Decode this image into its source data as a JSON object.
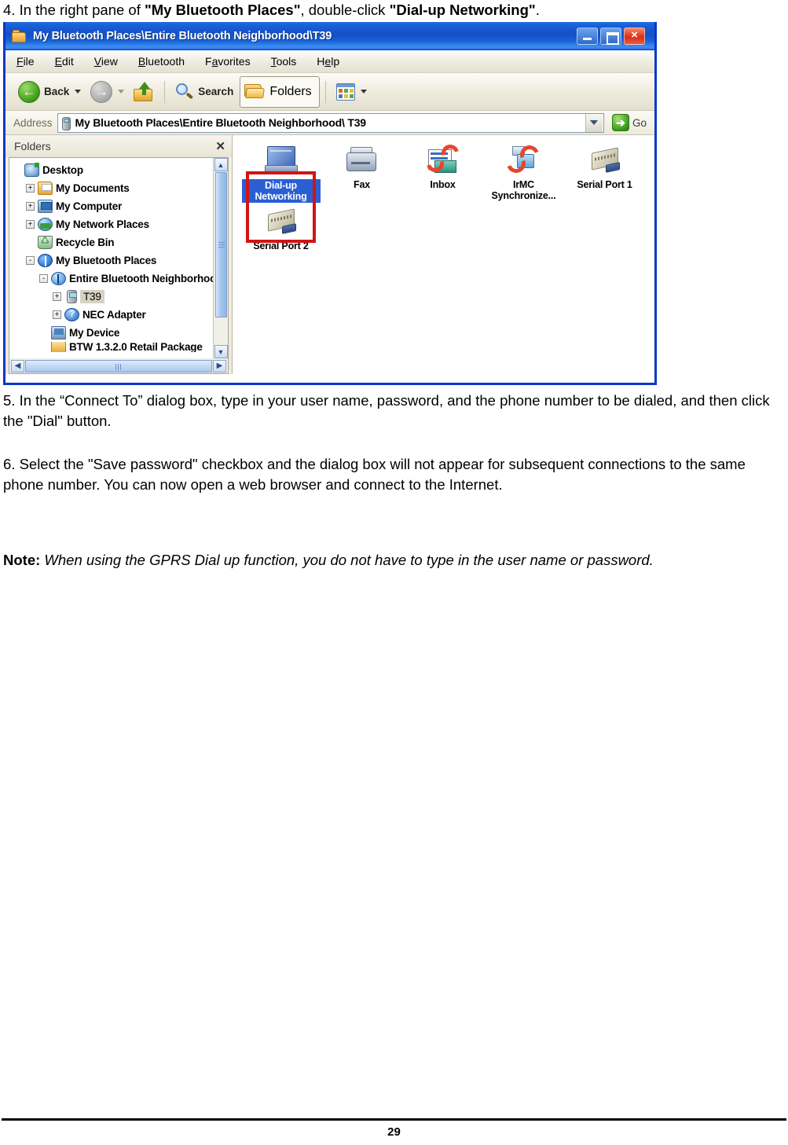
{
  "document": {
    "step4": {
      "prefix": "4. In the right pane of ",
      "bold1": "\"My Bluetooth Places\"",
      "middle": ", double-click ",
      "bold2": "\"Dial-up Networking\"",
      "suffix": "."
    },
    "step5": "5. In the “Connect To” dialog box, type in your user name, password, and the phone number to be dialed, and then click the \"Dial\" button.",
    "step6": "6. Select the \"Save password\" checkbox and the dialog box will not appear for subsequent connections to the same phone number. You can now open a web browser and connect to the Internet.",
    "note": {
      "label": "Note:",
      "text": "When using the GPRS Dial up function, you do not have to type in the user name or password."
    },
    "footer": {
      "page_number": "29"
    }
  },
  "window": {
    "title": "My Bluetooth Places\\Entire Bluetooth Neighborhood\\T39",
    "title_icon": "folder-icon",
    "caption_buttons": {
      "minimize": "minimize-button",
      "maximize": "maximize-button",
      "close": "×"
    },
    "menu": [
      {
        "label": "File",
        "accel": "F"
      },
      {
        "label": "Edit",
        "accel": "E"
      },
      {
        "label": "View",
        "accel": "V"
      },
      {
        "label": "Bluetooth",
        "accel": "B"
      },
      {
        "label": "Favorites",
        "accel": "a"
      },
      {
        "label": "Tools",
        "accel": "T"
      },
      {
        "label": "Help",
        "accel": "H"
      }
    ],
    "toolbar": {
      "back_label": "Back",
      "forward_label": "",
      "up_label": "",
      "search_label": "Search",
      "folders_label": "Folders",
      "views_label": ""
    },
    "address": {
      "label": "Address",
      "value": "My Bluetooth Places\\Entire Bluetooth Neighborhood\\ T39",
      "go_label": "Go"
    },
    "folders_pane": {
      "header": "Folders",
      "close_glyph": "✕",
      "tree": [
        {
          "label": "Desktop",
          "indent": 0,
          "expander": "",
          "icon": "desktop-icon",
          "selected": false
        },
        {
          "label": "My Documents",
          "indent": 1,
          "expander": "+",
          "icon": "my-documents-icon",
          "selected": false
        },
        {
          "label": "My Computer",
          "indent": 1,
          "expander": "+",
          "icon": "my-computer-icon",
          "selected": false
        },
        {
          "label": "My Network Places",
          "indent": 1,
          "expander": "+",
          "icon": "network-icon",
          "selected": false
        },
        {
          "label": "Recycle Bin",
          "indent": 1,
          "expander": "",
          "icon": "recycle-bin-icon",
          "selected": false
        },
        {
          "label": "My Bluetooth Places",
          "indent": 1,
          "expander": "-",
          "icon": "bluetooth-icon",
          "selected": false
        },
        {
          "label": "Entire Bluetooth Neighborhood",
          "indent": 2,
          "expander": "-",
          "icon": "bluetooth-globe-icon",
          "selected": false
        },
        {
          "label": "T39",
          "indent": 3,
          "expander": "+",
          "icon": "phone-icon",
          "selected": true
        },
        {
          "label": "NEC Adapter",
          "indent": 3,
          "expander": "+",
          "icon": "adapter-icon",
          "selected": false
        },
        {
          "label": "My Device",
          "indent": 2,
          "expander": "",
          "icon": "my-device-icon",
          "selected": false
        },
        {
          "label": "BTW 1.3.2.0 Retail Package",
          "indent": 2,
          "expander": "",
          "icon": "folder-icon",
          "selected": false
        }
      ]
    },
    "content_pane": {
      "items": [
        {
          "label": "Dial-up Networking",
          "icon": "dial-up-networking-icon",
          "selected": true
        },
        {
          "label": "Fax",
          "icon": "fax-icon",
          "selected": false
        },
        {
          "label": "Inbox",
          "icon": "inbox-icon",
          "selected": false
        },
        {
          "label": "IrMC Synchronize...",
          "icon": "irmc-sync-icon",
          "selected": false
        },
        {
          "label": "Serial Port 1",
          "icon": "serial-port-icon",
          "selected": false
        },
        {
          "label": "Serial Port 2",
          "icon": "serial-port-icon",
          "selected": false
        }
      ],
      "highlight_annotation": "red-callout-box"
    }
  },
  "colors": {
    "titlebar_blue": "#1350C6",
    "window_border": "#0A38C8",
    "selection_blue": "#2A5FD4",
    "annotation_red": "#D01515",
    "go_green": "#3F9C1B"
  }
}
